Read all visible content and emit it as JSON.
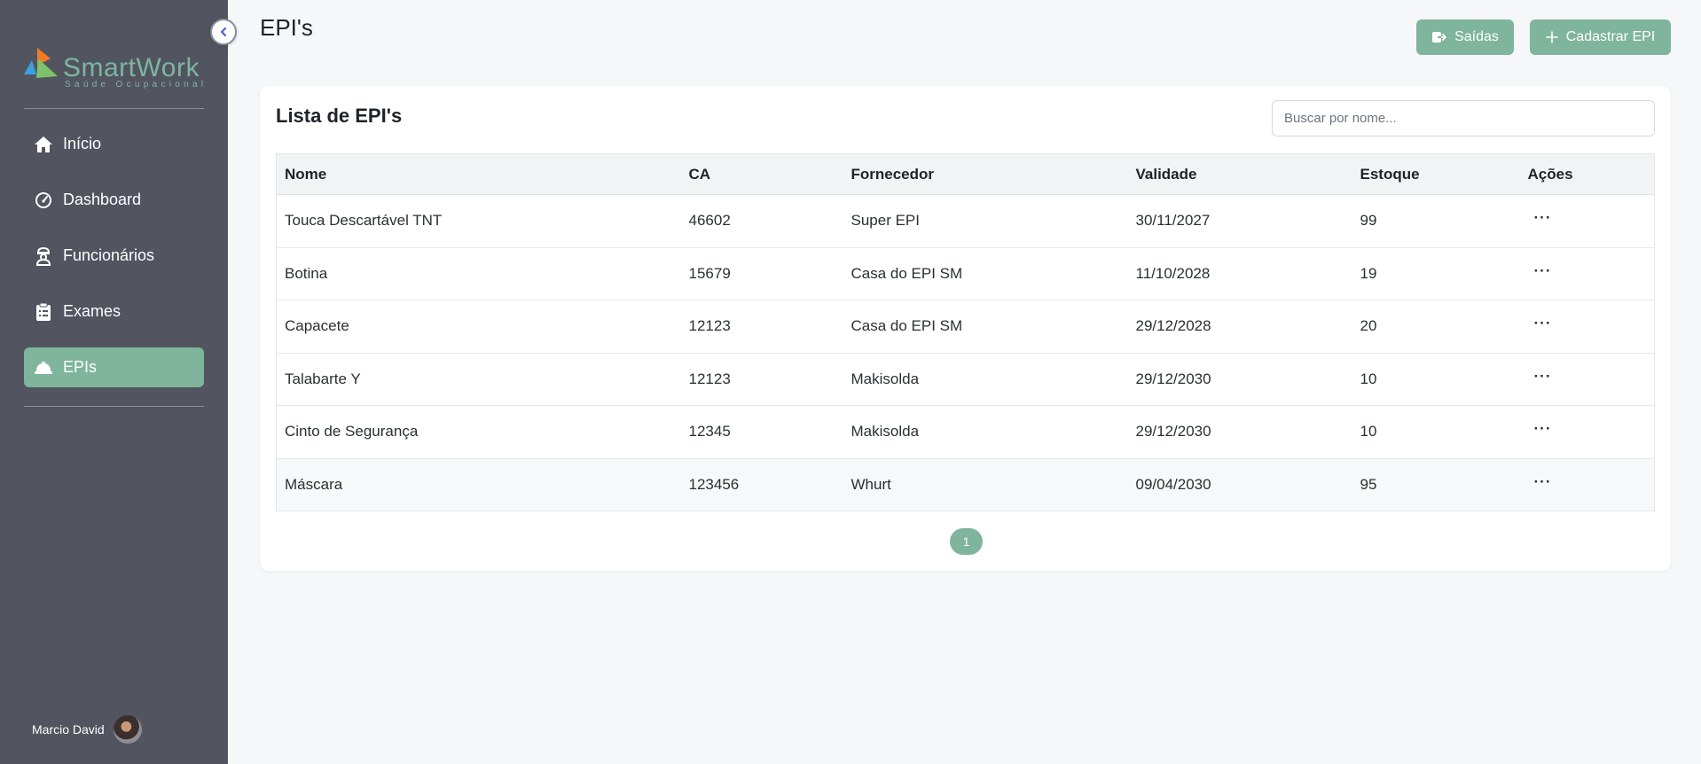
{
  "brand": {
    "name": "SmartWork",
    "tagline": "Saúde Ocupacional",
    "accent": "#7fb49d",
    "sidebar_bg": "#525460"
  },
  "sidebar": {
    "items": [
      {
        "label": "Início",
        "icon": "home-icon",
        "active": false
      },
      {
        "label": "Dashboard",
        "icon": "gauge-icon",
        "active": false
      },
      {
        "label": "Funcionários",
        "icon": "worker-icon",
        "active": false
      },
      {
        "label": "Exames",
        "icon": "clipboard-icon",
        "active": false
      },
      {
        "label": "EPIs",
        "icon": "hard-hat-icon",
        "active": true
      }
    ],
    "user_name": "Marcio David"
  },
  "header": {
    "title": "EPI's",
    "saidas_label": "Saídas",
    "cadastrar_label": "Cadastrar EPI"
  },
  "card": {
    "title": "Lista de EPI's",
    "search_placeholder": "Buscar por nome..."
  },
  "table": {
    "columns": [
      "Nome",
      "CA",
      "Fornecedor",
      "Validade",
      "Estoque",
      "Ações"
    ],
    "rows": [
      {
        "nome": "Touca Descartável TNT",
        "ca": "46602",
        "fornecedor": "Super EPI",
        "validade": "30/11/2027",
        "estoque": "99"
      },
      {
        "nome": "Botina",
        "ca": "15679",
        "fornecedor": "Casa do EPI SM",
        "validade": "11/10/2028",
        "estoque": "19"
      },
      {
        "nome": "Capacete",
        "ca": "12123",
        "fornecedor": "Casa do EPI SM",
        "validade": "29/12/2028",
        "estoque": "20"
      },
      {
        "nome": "Talabarte Y",
        "ca": "12123",
        "fornecedor": "Makisolda",
        "validade": "29/12/2030",
        "estoque": "10"
      },
      {
        "nome": "Cinto de Segurança",
        "ca": "12345",
        "fornecedor": "Makisolda",
        "validade": "29/12/2030",
        "estoque": "10"
      },
      {
        "nome": "Máscara",
        "ca": "123456",
        "fornecedor": "Whurt",
        "validade": "09/04/2030",
        "estoque": "95"
      }
    ],
    "actions_glyph": "···"
  },
  "pagination": {
    "current": "1"
  }
}
